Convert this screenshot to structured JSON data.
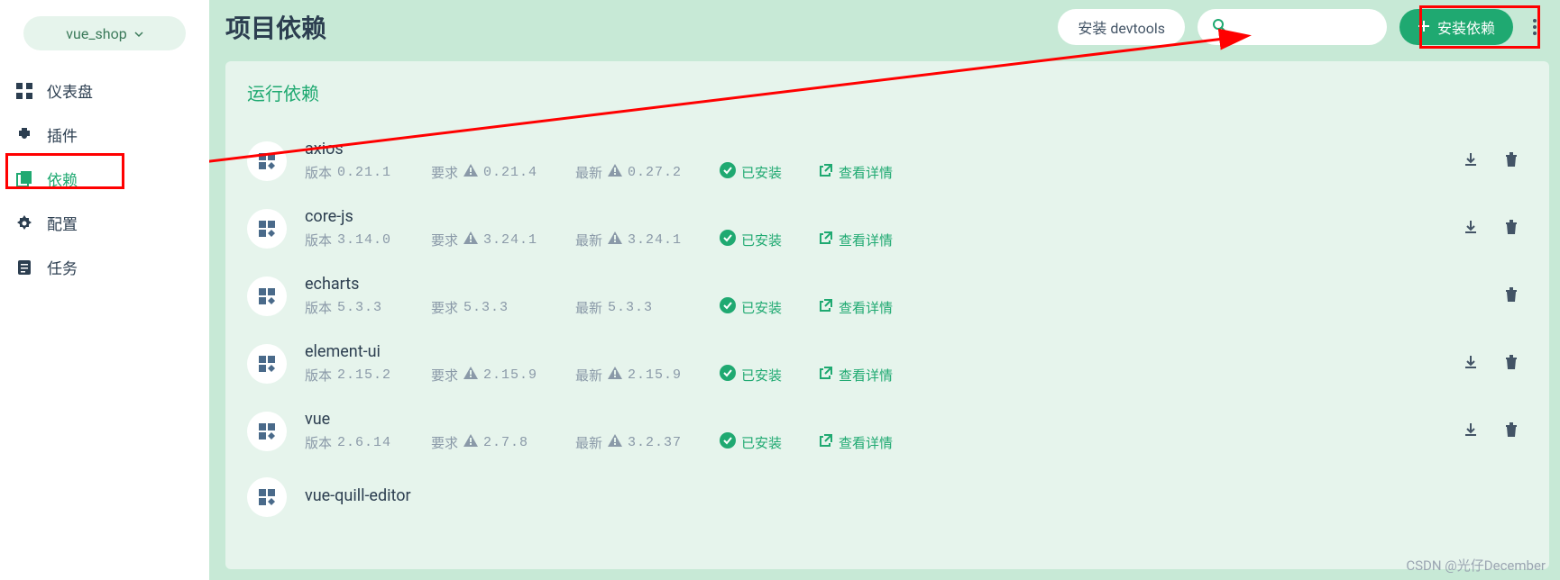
{
  "project": {
    "name": "vue_shop"
  },
  "sidebar": {
    "items": [
      {
        "label": "仪表盘",
        "icon": "dashboard-icon"
      },
      {
        "label": "插件",
        "icon": "plugin-icon"
      },
      {
        "label": "依赖",
        "icon": "dependency-icon",
        "active": true
      },
      {
        "label": "配置",
        "icon": "config-icon"
      },
      {
        "label": "任务",
        "icon": "task-icon"
      }
    ]
  },
  "header": {
    "title": "项目依赖",
    "devtools_label": "安装 devtools",
    "search_placeholder": "",
    "install_label": "安装依赖"
  },
  "section": {
    "title": "运行依赖"
  },
  "labels": {
    "version": "版本",
    "required": "要求",
    "latest": "最新",
    "installed": "已安装",
    "detail": "查看详情"
  },
  "deps": [
    {
      "name": "axios",
      "version": "0.21.1",
      "required": "0.21.4",
      "latest": "0.27.2",
      "req_warn": true,
      "latest_warn": true,
      "download": true,
      "delete": true
    },
    {
      "name": "core-js",
      "version": "3.14.0",
      "required": "3.24.1",
      "latest": "3.24.1",
      "req_warn": true,
      "latest_warn": true,
      "download": true,
      "delete": true
    },
    {
      "name": "echarts",
      "version": "5.3.3",
      "required": "5.3.3",
      "latest": "5.3.3",
      "req_warn": false,
      "latest_warn": false,
      "download": false,
      "delete": true
    },
    {
      "name": "element-ui",
      "version": "2.15.2",
      "required": "2.15.9",
      "latest": "2.15.9",
      "req_warn": true,
      "latest_warn": true,
      "download": true,
      "delete": true
    },
    {
      "name": "vue",
      "version": "2.6.14",
      "required": "2.7.8",
      "latest": "3.2.37",
      "req_warn": true,
      "latest_warn": true,
      "download": true,
      "delete": true
    },
    {
      "name": "vue-quill-editor",
      "version": "",
      "required": "",
      "latest": "",
      "req_warn": false,
      "latest_warn": false,
      "download": false,
      "delete": false
    }
  ],
  "watermark": "CSDN @光仔December"
}
